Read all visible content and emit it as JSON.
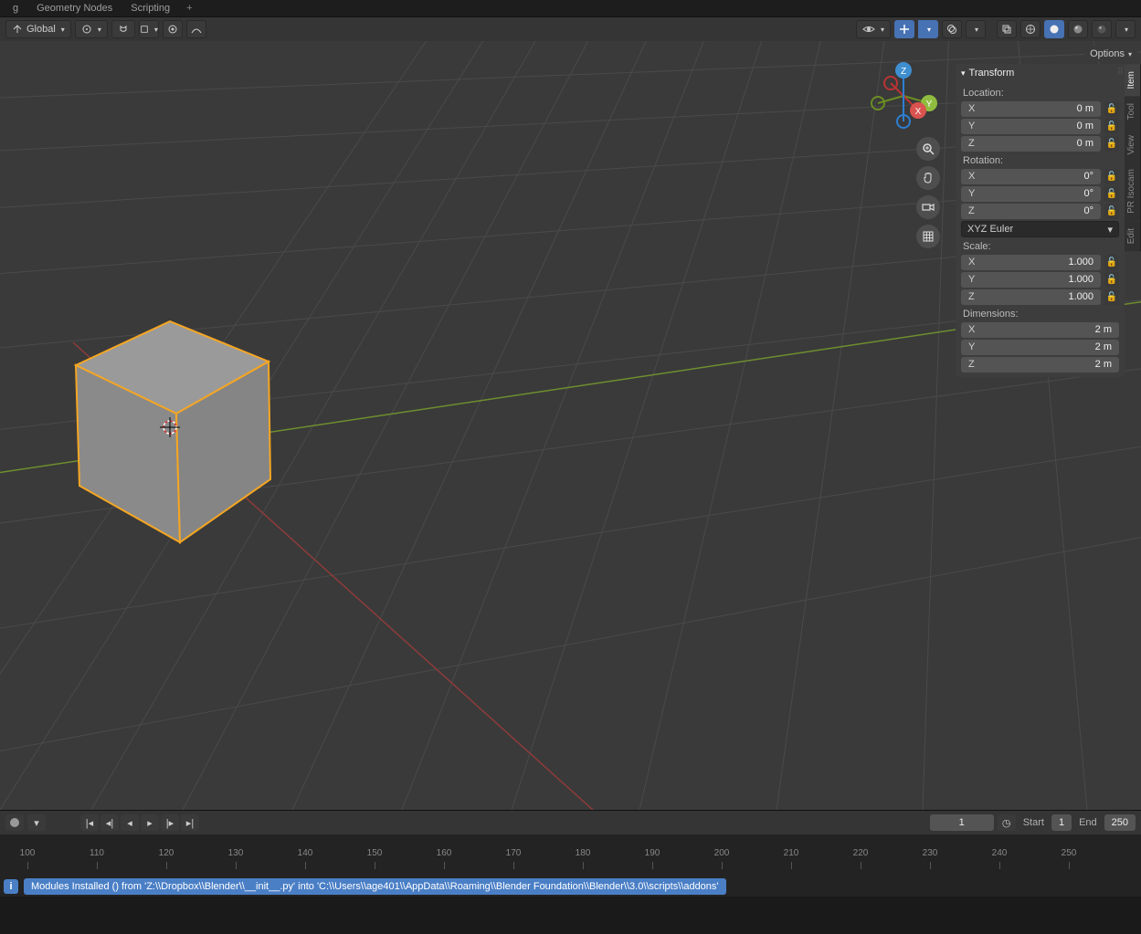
{
  "topbar": {
    "tabs": [
      "g",
      "Geometry Nodes",
      "Scripting"
    ]
  },
  "header": {
    "orientation": "Global",
    "options_label": "Options"
  },
  "sidetabs": [
    "Item",
    "Tool",
    "View",
    "PR Isocam",
    "Edit"
  ],
  "panel": {
    "title": "Transform",
    "location_label": "Location:",
    "rotation_label": "Rotation:",
    "scale_label": "Scale:",
    "dimensions_label": "Dimensions:",
    "location": {
      "X": "0 m",
      "Y": "0 m",
      "Z": "0 m"
    },
    "rotation": {
      "X": "0°",
      "Y": "0°",
      "Z": "0°"
    },
    "rotation_mode": "XYZ Euler",
    "scale": {
      "X": "1.000",
      "Y": "1.000",
      "Z": "1.000"
    },
    "dimensions": {
      "X": "2 m",
      "Y": "2 m",
      "Z": "2 m"
    }
  },
  "gizmo_axes": {
    "X": "X",
    "Y": "Y",
    "Z": "Z"
  },
  "timeline": {
    "current_frame": "1",
    "start_label": "Start",
    "start": "1",
    "end_label": "End",
    "end": "250",
    "ticks": [
      "100",
      "110",
      "120",
      "130",
      "140",
      "150",
      "160",
      "170",
      "180",
      "190",
      "200",
      "210",
      "220",
      "230",
      "240",
      "250"
    ]
  },
  "status": {
    "message": "Modules Installed () from 'Z:\\\\Dropbox\\\\Blender\\\\__init__.py' into 'C:\\\\Users\\\\age401\\\\AppData\\\\Roaming\\\\Blender Foundation\\\\Blender\\\\3.0\\\\scripts\\\\addons'"
  }
}
